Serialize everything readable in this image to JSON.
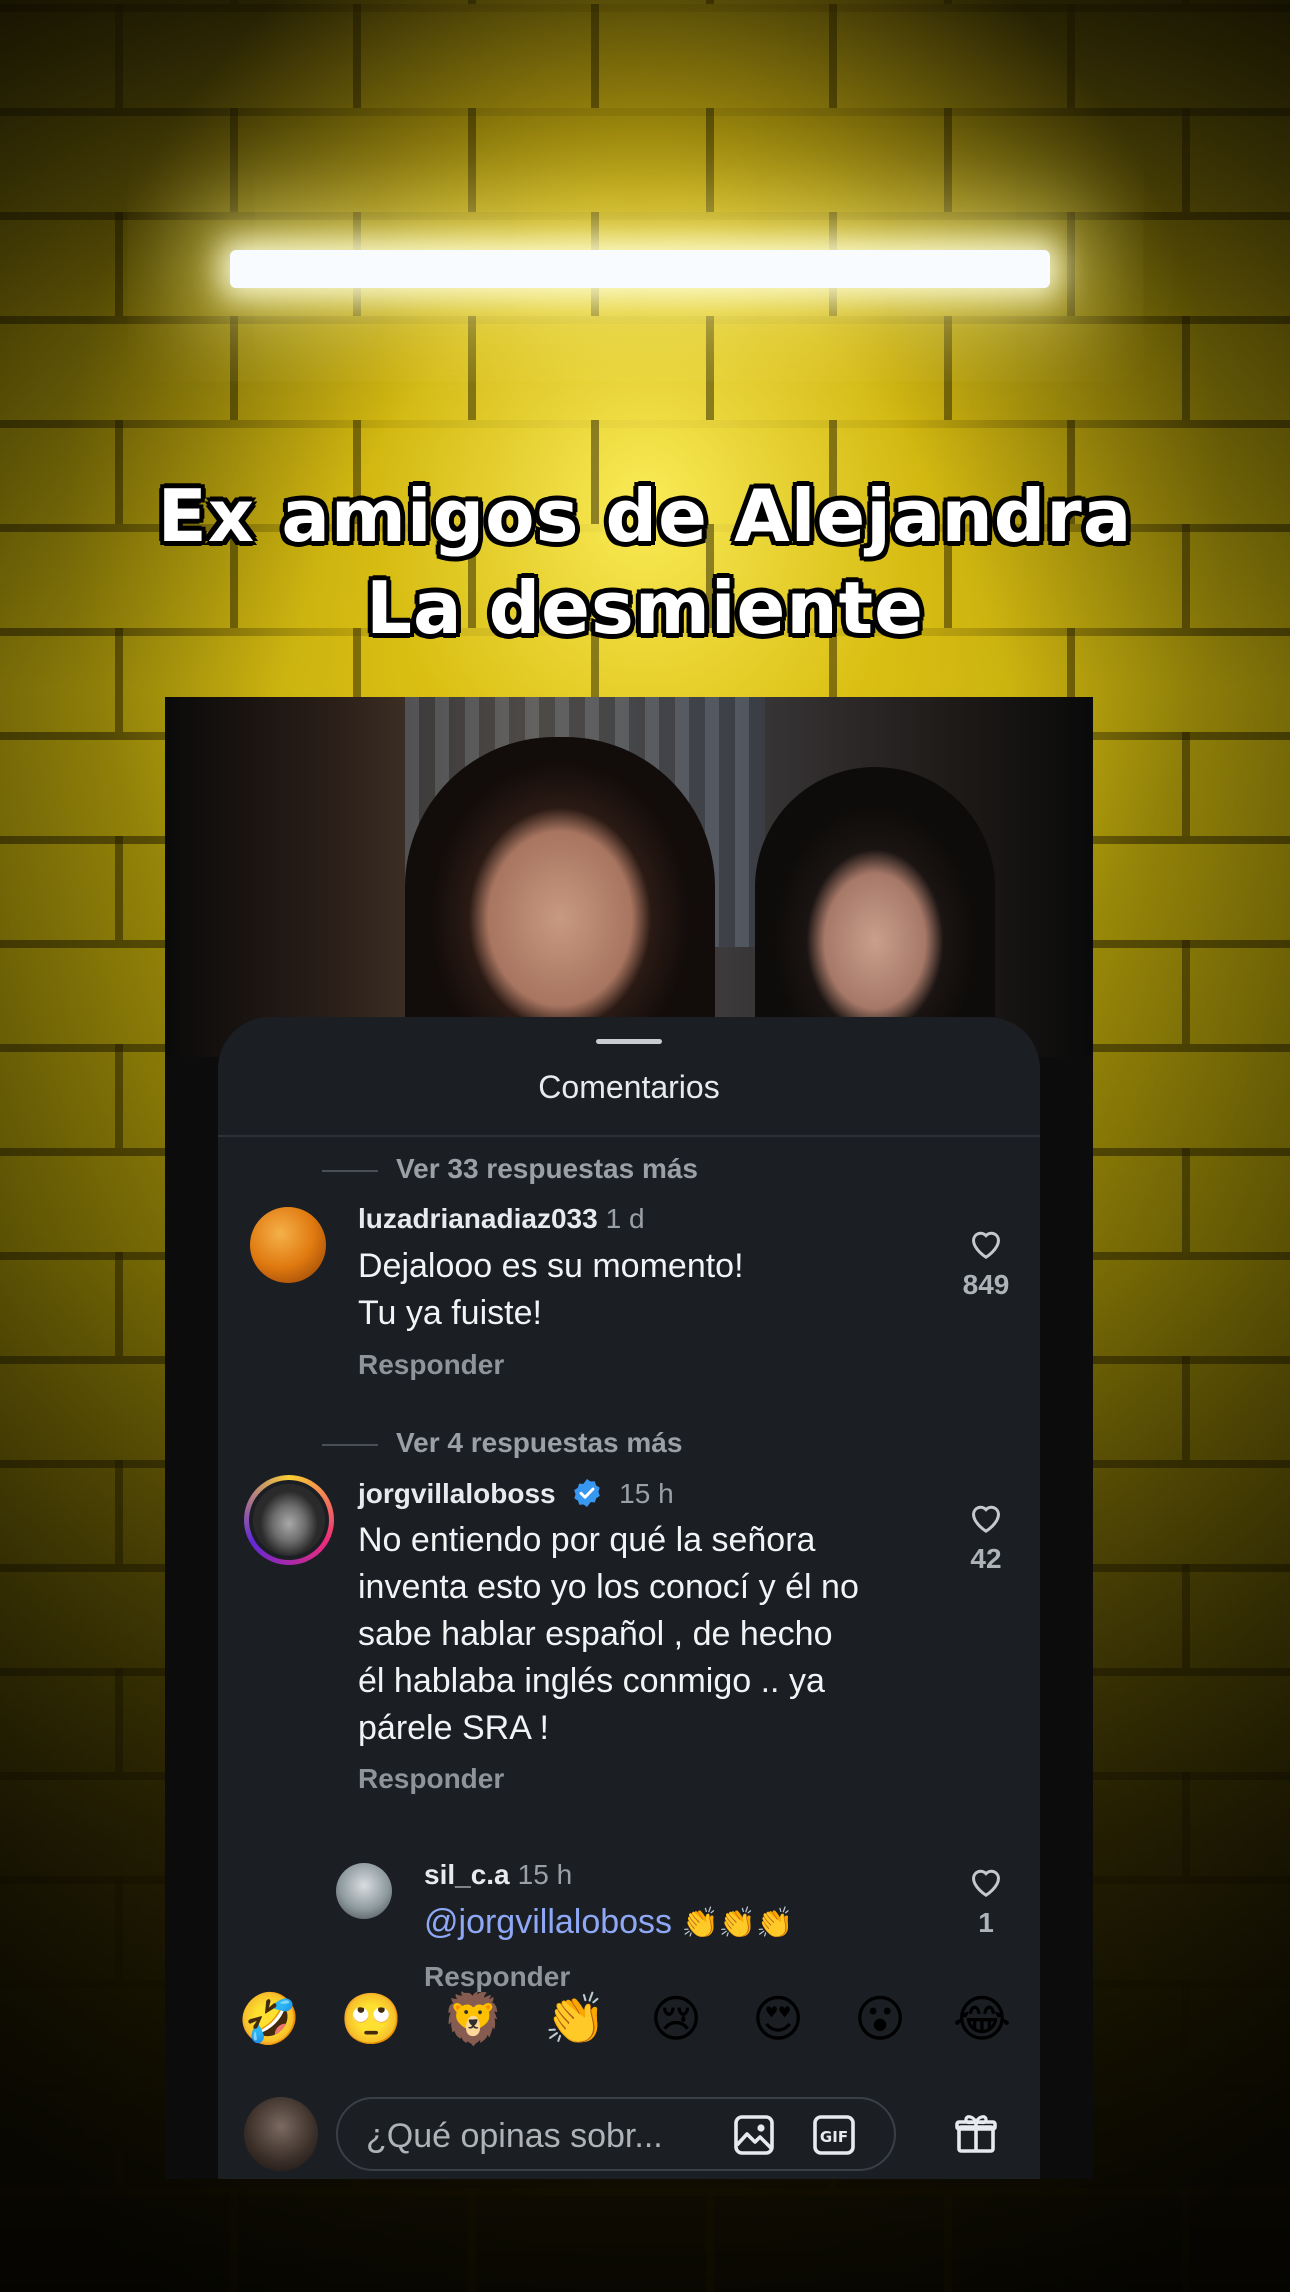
{
  "overlay": {
    "headline_line1": "Ex amigos de Alejandra",
    "headline_line2": "La desmiente"
  },
  "sheet": {
    "title": "Comentarios"
  },
  "comments": [
    {
      "more_replies": "Ver 33 respuestas más",
      "username": "luzadrianadiaz033",
      "time": "1 d",
      "text_line1": "Dejalooo es su momento!",
      "text_line2": "Tu ya fuiste!",
      "reply": "Responder",
      "likes": "849"
    },
    {
      "more_replies": "Ver 4 respuestas más",
      "username": "jorgvillaloboss",
      "verified": true,
      "time": "15 h",
      "text_lines": [
        "No entiendo por qué la señora",
        "inventa esto yo los conocí y él no",
        "sabe hablar español , de hecho",
        "él hablaba inglés conmigo .. ya",
        "párele SRA !"
      ],
      "reply": "Responder",
      "likes": "42"
    },
    {
      "username": "sil_c.a",
      "time": "15 h",
      "mention": "@jorgvillaloboss",
      "emojis": "👏👏👏",
      "reply": "Responder",
      "likes": "1"
    }
  ],
  "quick_emojis": [
    "🤣",
    "🙄",
    "🦁",
    "👏",
    "😢",
    "😍",
    "😮",
    "😂"
  ],
  "composer": {
    "placeholder": "¿Qué opinas sobr...",
    "icons": [
      "image-icon",
      "gif-icon",
      "gift-icon"
    ]
  },
  "colors": {
    "sheet_bg": "#1b1f24",
    "accent_mention": "#8fa8f5",
    "verified_blue": "#3897f0",
    "headline_text": "#ffffff"
  }
}
